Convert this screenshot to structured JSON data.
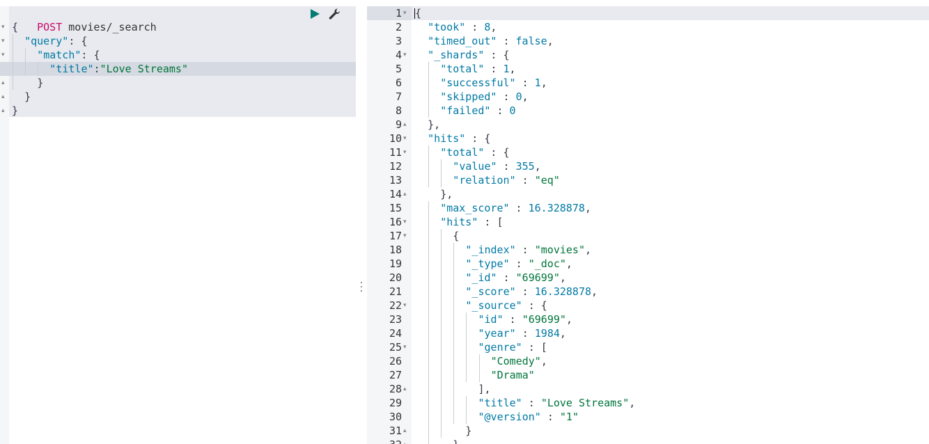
{
  "request": {
    "method": "POST",
    "path": "movies/_search",
    "lines": [
      {
        "fold": "▾",
        "indent": 0,
        "parts": [
          [
            "punc",
            "{"
          ]
        ]
      },
      {
        "fold": "▾",
        "indent": 1,
        "parts": [
          [
            "key",
            "\"query\""
          ],
          [
            "punc",
            ": {"
          ]
        ]
      },
      {
        "fold": "▾",
        "indent": 2,
        "parts": [
          [
            "key",
            "\"match\""
          ],
          [
            "punc",
            ": {"
          ]
        ]
      },
      {
        "fold": "",
        "indent": 3,
        "parts": [
          [
            "key",
            "\"title\""
          ],
          [
            "punc",
            ":"
          ],
          [
            "str",
            "\"Love Streams\""
          ]
        ]
      },
      {
        "fold": "▴",
        "indent": 2,
        "parts": [
          [
            "punc",
            "}"
          ]
        ]
      },
      {
        "fold": "▴",
        "indent": 1,
        "parts": [
          [
            "punc",
            "}"
          ]
        ]
      },
      {
        "fold": "▴",
        "indent": 0,
        "parts": [
          [
            "punc",
            "}"
          ]
        ]
      }
    ]
  },
  "icons": {
    "run": "play-icon",
    "settings": "wrench-icon",
    "resize": "vertical-dots-icon"
  },
  "colors": {
    "method": "#c80a68",
    "key": "#0079a5",
    "string": "#00753b",
    "number": "#0079a5"
  },
  "response": {
    "lines": [
      {
        "n": "1",
        "fold": "▾",
        "indent": 0,
        "parts": [
          [
            "punc",
            "{"
          ]
        ]
      },
      {
        "n": "2",
        "fold": "",
        "indent": 1,
        "parts": [
          [
            "key",
            "\"took\""
          ],
          [
            "punc",
            " : "
          ],
          [
            "num",
            "8"
          ],
          [
            "punc",
            ","
          ]
        ]
      },
      {
        "n": "3",
        "fold": "",
        "indent": 1,
        "parts": [
          [
            "key",
            "\"timed_out\""
          ],
          [
            "punc",
            " : "
          ],
          [
            "kw",
            "false"
          ],
          [
            "punc",
            ","
          ]
        ]
      },
      {
        "n": "4",
        "fold": "▾",
        "indent": 1,
        "parts": [
          [
            "key",
            "\"_shards\""
          ],
          [
            "punc",
            " : {"
          ]
        ]
      },
      {
        "n": "5",
        "fold": "",
        "indent": 2,
        "parts": [
          [
            "key",
            "\"total\""
          ],
          [
            "punc",
            " : "
          ],
          [
            "num",
            "1"
          ],
          [
            "punc",
            ","
          ]
        ]
      },
      {
        "n": "6",
        "fold": "",
        "indent": 2,
        "parts": [
          [
            "key",
            "\"successful\""
          ],
          [
            "punc",
            " : "
          ],
          [
            "num",
            "1"
          ],
          [
            "punc",
            ","
          ]
        ]
      },
      {
        "n": "7",
        "fold": "",
        "indent": 2,
        "parts": [
          [
            "key",
            "\"skipped\""
          ],
          [
            "punc",
            " : "
          ],
          [
            "num",
            "0"
          ],
          [
            "punc",
            ","
          ]
        ]
      },
      {
        "n": "8",
        "fold": "",
        "indent": 2,
        "parts": [
          [
            "key",
            "\"failed\""
          ],
          [
            "punc",
            " : "
          ],
          [
            "num",
            "0"
          ]
        ]
      },
      {
        "n": "9",
        "fold": "▴",
        "indent": 1,
        "parts": [
          [
            "punc",
            "},"
          ]
        ]
      },
      {
        "n": "10",
        "fold": "▾",
        "indent": 1,
        "parts": [
          [
            "key",
            "\"hits\""
          ],
          [
            "punc",
            " : {"
          ]
        ]
      },
      {
        "n": "11",
        "fold": "▾",
        "indent": 2,
        "parts": [
          [
            "key",
            "\"total\""
          ],
          [
            "punc",
            " : {"
          ]
        ]
      },
      {
        "n": "12",
        "fold": "",
        "indent": 3,
        "parts": [
          [
            "key",
            "\"value\""
          ],
          [
            "punc",
            " : "
          ],
          [
            "num",
            "355"
          ],
          [
            "punc",
            ","
          ]
        ]
      },
      {
        "n": "13",
        "fold": "",
        "indent": 3,
        "parts": [
          [
            "key",
            "\"relation\""
          ],
          [
            "punc",
            " : "
          ],
          [
            "str",
            "\"eq\""
          ]
        ]
      },
      {
        "n": "14",
        "fold": "▴",
        "indent": 2,
        "parts": [
          [
            "punc",
            "},"
          ]
        ]
      },
      {
        "n": "15",
        "fold": "",
        "indent": 2,
        "parts": [
          [
            "key",
            "\"max_score\""
          ],
          [
            "punc",
            " : "
          ],
          [
            "num",
            "16.328878"
          ],
          [
            "punc",
            ","
          ]
        ]
      },
      {
        "n": "16",
        "fold": "▾",
        "indent": 2,
        "parts": [
          [
            "key",
            "\"hits\""
          ],
          [
            "punc",
            " : ["
          ]
        ]
      },
      {
        "n": "17",
        "fold": "▾",
        "indent": 3,
        "parts": [
          [
            "punc",
            "{"
          ]
        ]
      },
      {
        "n": "18",
        "fold": "",
        "indent": 4,
        "parts": [
          [
            "key",
            "\"_index\""
          ],
          [
            "punc",
            " : "
          ],
          [
            "str",
            "\"movies\""
          ],
          [
            "punc",
            ","
          ]
        ]
      },
      {
        "n": "19",
        "fold": "",
        "indent": 4,
        "parts": [
          [
            "key",
            "\"_type\""
          ],
          [
            "punc",
            " : "
          ],
          [
            "str",
            "\"_doc\""
          ],
          [
            "punc",
            ","
          ]
        ]
      },
      {
        "n": "20",
        "fold": "",
        "indent": 4,
        "parts": [
          [
            "key",
            "\"_id\""
          ],
          [
            "punc",
            " : "
          ],
          [
            "str",
            "\"69699\""
          ],
          [
            "punc",
            ","
          ]
        ]
      },
      {
        "n": "21",
        "fold": "",
        "indent": 4,
        "parts": [
          [
            "key",
            "\"_score\""
          ],
          [
            "punc",
            " : "
          ],
          [
            "num",
            "16.328878"
          ],
          [
            "punc",
            ","
          ]
        ]
      },
      {
        "n": "22",
        "fold": "▾",
        "indent": 4,
        "parts": [
          [
            "key",
            "\"_source\""
          ],
          [
            "punc",
            " : {"
          ]
        ]
      },
      {
        "n": "23",
        "fold": "",
        "indent": 5,
        "parts": [
          [
            "key",
            "\"id\""
          ],
          [
            "punc",
            " : "
          ],
          [
            "str",
            "\"69699\""
          ],
          [
            "punc",
            ","
          ]
        ]
      },
      {
        "n": "24",
        "fold": "",
        "indent": 5,
        "parts": [
          [
            "key",
            "\"year\""
          ],
          [
            "punc",
            " : "
          ],
          [
            "num",
            "1984"
          ],
          [
            "punc",
            ","
          ]
        ]
      },
      {
        "n": "25",
        "fold": "▾",
        "indent": 5,
        "parts": [
          [
            "key",
            "\"genre\""
          ],
          [
            "punc",
            " : ["
          ]
        ]
      },
      {
        "n": "26",
        "fold": "",
        "indent": 6,
        "parts": [
          [
            "str",
            "\"Comedy\""
          ],
          [
            "punc",
            ","
          ]
        ]
      },
      {
        "n": "27",
        "fold": "",
        "indent": 6,
        "parts": [
          [
            "str",
            "\"Drama\""
          ]
        ]
      },
      {
        "n": "28",
        "fold": "▴",
        "indent": 5,
        "parts": [
          [
            "punc",
            "],"
          ]
        ]
      },
      {
        "n": "29",
        "fold": "",
        "indent": 5,
        "parts": [
          [
            "key",
            "\"title\""
          ],
          [
            "punc",
            " : "
          ],
          [
            "str",
            "\"Love Streams\""
          ],
          [
            "punc",
            ","
          ]
        ]
      },
      {
        "n": "30",
        "fold": "",
        "indent": 5,
        "parts": [
          [
            "key",
            "\"@version\""
          ],
          [
            "punc",
            " : "
          ],
          [
            "str",
            "\"1\""
          ]
        ]
      },
      {
        "n": "31",
        "fold": "▴",
        "indent": 4,
        "parts": [
          [
            "punc",
            "}"
          ]
        ]
      },
      {
        "n": "32",
        "fold": "▴",
        "indent": 3,
        "parts": [
          [
            "punc",
            "},"
          ]
        ]
      }
    ]
  }
}
